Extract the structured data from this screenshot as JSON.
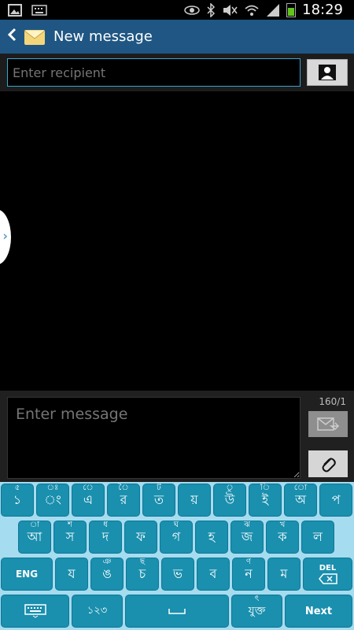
{
  "status_bar": {
    "time": "18:29",
    "left_icons": [
      "gallery-icon",
      "keyboard-icon"
    ],
    "right_icons": [
      "eye-icon",
      "bluetooth-icon",
      "mute-icon",
      "wifi-icon",
      "signal-icon",
      "battery-icon"
    ]
  },
  "action_bar": {
    "title": "New message"
  },
  "recipient": {
    "placeholder": "Enter recipient"
  },
  "compose": {
    "placeholder": "Enter message",
    "counter": "160/1"
  },
  "keyboard": {
    "row1": [
      {
        "main": "১",
        "sec": "৫"
      },
      {
        "main": "ং",
        "sec": "ঃ"
      },
      {
        "main": "এ",
        "sec": "ে"
      },
      {
        "main": "র",
        "sec": "ৈ"
      },
      {
        "main": "ত",
        "sec": "ট"
      },
      {
        "main": "য়",
        "sec": ""
      },
      {
        "main": "উ",
        "sec": "ু"
      },
      {
        "main": "ই",
        "sec": "ি"
      },
      {
        "main": "অ",
        "sec": "ো"
      },
      {
        "main": "প",
        "sec": ""
      }
    ],
    "row2": [
      {
        "main": "আ",
        "sec": "া"
      },
      {
        "main": "স",
        "sec": "শ"
      },
      {
        "main": "দ",
        "sec": "ধ"
      },
      {
        "main": "ফ",
        "sec": ""
      },
      {
        "main": "গ",
        "sec": "ঘ"
      },
      {
        "main": "হ",
        "sec": ""
      },
      {
        "main": "জ",
        "sec": "ঝ"
      },
      {
        "main": "ক",
        "sec": "খ"
      },
      {
        "main": "ল",
        "sec": ""
      }
    ],
    "row3": [
      {
        "main": "ENG",
        "sec": ""
      },
      {
        "main": "য",
        "sec": ""
      },
      {
        "main": "ঙ",
        "sec": "ঞ"
      },
      {
        "main": "চ",
        "sec": "ছ"
      },
      {
        "main": "ভ",
        "sec": ""
      },
      {
        "main": "ব",
        "sec": ""
      },
      {
        "main": "ন",
        "sec": "ণ"
      },
      {
        "main": "ম",
        "sec": ""
      }
    ],
    "del_label": "DEL",
    "row4": {
      "numbers": "১২৩",
      "space": "",
      "conjunct": "যুক্ত",
      "conjunct_sec": "ৎ",
      "next": "Next"
    }
  },
  "colors": {
    "action_bar": "#1f5683",
    "key": "#1a8fae",
    "keyboard_bg": "#a6dcef",
    "input_border": "#3aa5d0"
  }
}
